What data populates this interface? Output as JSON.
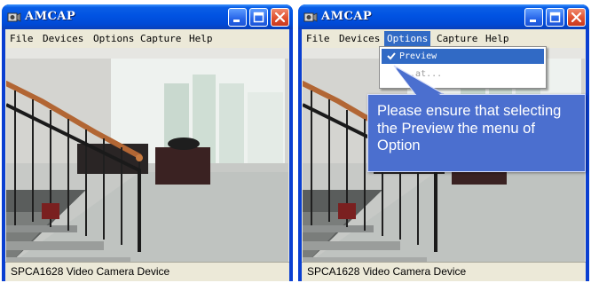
{
  "left_window": {
    "title": "AMCAP",
    "menu": [
      "File",
      "Devices",
      "Options",
      "Capture",
      "Help"
    ],
    "status": "SPCA1628 Video Camera Device"
  },
  "right_window": {
    "title": "AMCAP",
    "menu": [
      "File",
      "Devices",
      "Options",
      "Capture",
      "Help"
    ],
    "active_menu": "Options",
    "options_menu": {
      "items": [
        {
          "label": "Preview",
          "checked": true,
          "highlighted": true
        },
        {
          "label": "...at...",
          "enabled": false
        }
      ]
    },
    "status": "SPCA1628 Video Camera Device"
  },
  "callout": {
    "text": "Please ensure that selecting the Preview the menu of Option"
  },
  "colors": {
    "titlebar": "#0153e2",
    "menu_highlight": "#316ac5",
    "callout_fill": "#4b6fcf",
    "close_button": "#e0512f"
  }
}
